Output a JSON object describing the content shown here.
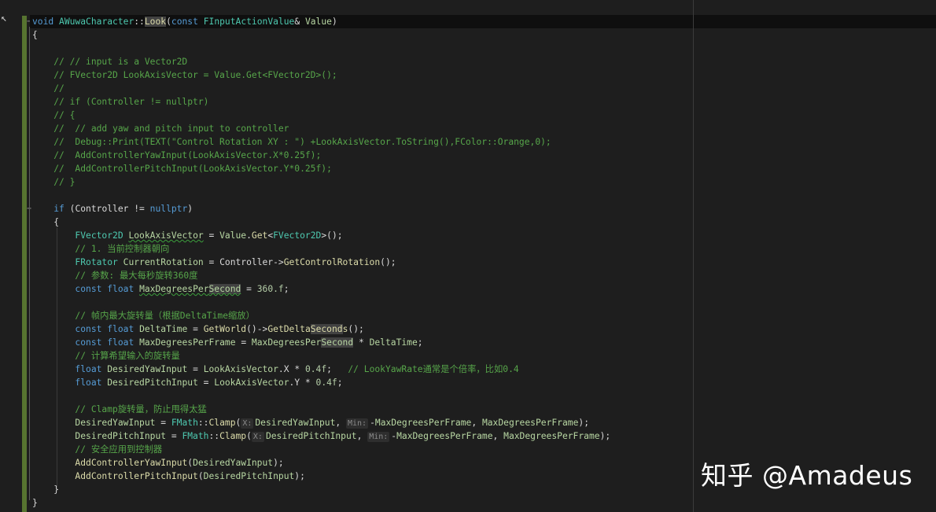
{
  "editor": {
    "cursor_glyph": "↖",
    "lines": [
      [
        {
          "t": "void",
          "c": "kw"
        },
        {
          "t": " "
        },
        {
          "t": "AWuwaCharacter",
          "c": "ty"
        },
        {
          "t": "::"
        },
        {
          "t": "Look",
          "c": "fn",
          "hl": true
        },
        {
          "t": "("
        },
        {
          "t": "const",
          "c": "kw"
        },
        {
          "t": " "
        },
        {
          "t": "FInputActionValue",
          "c": "ty"
        },
        {
          "t": "& "
        },
        {
          "t": "Value",
          "c": "lp"
        },
        {
          "t": ")"
        }
      ],
      [
        {
          "t": "{"
        }
      ],
      [],
      [
        {
          "t": "    // // input is a Vector2D",
          "c": "cm"
        }
      ],
      [
        {
          "t": "    // FVector2D LookAxisVector = Value.Get<FVector2D>();",
          "c": "cm"
        }
      ],
      [
        {
          "t": "    //",
          "c": "cm"
        }
      ],
      [
        {
          "t": "    // if (Controller != nullptr)",
          "c": "cm"
        }
      ],
      [
        {
          "t": "    // {",
          "c": "cm"
        }
      ],
      [
        {
          "t": "    //  // add yaw and pitch input to controller",
          "c": "cm"
        }
      ],
      [
        {
          "t": "    //  Debug::Print(TEXT(\"Control Rotation XY : \") +LookAxisVector.ToString(),FColor::Orange,0);",
          "c": "cm"
        }
      ],
      [
        {
          "t": "    //  AddControllerYawInput(LookAxisVector.X*0.25f);",
          "c": "cm"
        }
      ],
      [
        {
          "t": "    //  AddControllerPitchInput(LookAxisVector.Y*0.25f);",
          "c": "cm"
        }
      ],
      [
        {
          "t": "    // }",
          "c": "cm"
        }
      ],
      [],
      [
        {
          "t": "    "
        },
        {
          "t": "if",
          "c": "kw"
        },
        {
          "t": " ("
        },
        {
          "t": "Controller",
          "c": "mb"
        },
        {
          "t": " != "
        },
        {
          "t": "nullptr",
          "c": "kw"
        },
        {
          "t": ")"
        }
      ],
      [
        {
          "t": "    {"
        }
      ],
      [
        {
          "t": "        "
        },
        {
          "t": "FVector2D",
          "c": "ty"
        },
        {
          "t": " "
        },
        {
          "t": "LookAxisVector",
          "c": "lp",
          "sq": true
        },
        {
          "t": " = "
        },
        {
          "t": "Value",
          "c": "lp"
        },
        {
          "t": "."
        },
        {
          "t": "Get",
          "c": "fn"
        },
        {
          "t": "<"
        },
        {
          "t": "FVector2D",
          "c": "ty"
        },
        {
          "t": ">();"
        }
      ],
      [
        {
          "t": "        // 1. 当前控制器朝向",
          "c": "cm"
        }
      ],
      [
        {
          "t": "        "
        },
        {
          "t": "FRotator",
          "c": "ty"
        },
        {
          "t": " "
        },
        {
          "t": "CurrentRotation",
          "c": "lp"
        },
        {
          "t": " = "
        },
        {
          "t": "Controller",
          "c": "mb"
        },
        {
          "t": "->"
        },
        {
          "t": "GetControlRotation",
          "c": "fn"
        },
        {
          "t": "();"
        }
      ],
      [
        {
          "t": "        // 参数: 最大每秒旋转360度",
          "c": "cm"
        }
      ],
      [
        {
          "t": "        "
        },
        {
          "t": "const",
          "c": "kw"
        },
        {
          "t": " "
        },
        {
          "t": "float",
          "c": "kw"
        },
        {
          "t": " "
        },
        {
          "t": "MaxDegreesPer",
          "c": "lp",
          "sq": true
        },
        {
          "t": "Second",
          "c": "lp",
          "sq": true,
          "hl": true
        },
        {
          "t": " = "
        },
        {
          "t": "360.f",
          "c": "nm"
        },
        {
          "t": ";"
        }
      ],
      [],
      [
        {
          "t": "        // 帧内最大旋转量（根据DeltaTime缩放）",
          "c": "cm"
        }
      ],
      [
        {
          "t": "        "
        },
        {
          "t": "const",
          "c": "kw"
        },
        {
          "t": " "
        },
        {
          "t": "float",
          "c": "kw"
        },
        {
          "t": " "
        },
        {
          "t": "DeltaTime",
          "c": "lp"
        },
        {
          "t": " = "
        },
        {
          "t": "GetWorld",
          "c": "fn"
        },
        {
          "t": "()->"
        },
        {
          "t": "GetDelta",
          "c": "fn"
        },
        {
          "t": "Second",
          "c": "fn",
          "hl": true
        },
        {
          "t": "s",
          "c": "fn"
        },
        {
          "t": "();"
        }
      ],
      [
        {
          "t": "        "
        },
        {
          "t": "const",
          "c": "kw"
        },
        {
          "t": " "
        },
        {
          "t": "float",
          "c": "kw"
        },
        {
          "t": " "
        },
        {
          "t": "MaxDegreesPerFrame",
          "c": "lp"
        },
        {
          "t": " = "
        },
        {
          "t": "MaxDegreesPer",
          "c": "lp"
        },
        {
          "t": "Second",
          "c": "lp",
          "hl": true
        },
        {
          "t": " * "
        },
        {
          "t": "DeltaTime",
          "c": "lp"
        },
        {
          "t": ";"
        }
      ],
      [
        {
          "t": "        // 计算希望输入的旋转量",
          "c": "cm"
        }
      ],
      [
        {
          "t": "        "
        },
        {
          "t": "float",
          "c": "kw"
        },
        {
          "t": " "
        },
        {
          "t": "DesiredYawInput",
          "c": "lp"
        },
        {
          "t": " = "
        },
        {
          "t": "LookAxisVector",
          "c": "lp"
        },
        {
          "t": "."
        },
        {
          "t": "X",
          "c": "mb"
        },
        {
          "t": " * "
        },
        {
          "t": "0.4f",
          "c": "nm"
        },
        {
          "t": ";   "
        },
        {
          "t": "// LookYawRate通常是个倍率，比如0.4",
          "c": "cm"
        }
      ],
      [
        {
          "t": "        "
        },
        {
          "t": "float",
          "c": "kw"
        },
        {
          "t": " "
        },
        {
          "t": "DesiredPitchInput",
          "c": "lp"
        },
        {
          "t": " = "
        },
        {
          "t": "LookAxisVector",
          "c": "lp"
        },
        {
          "t": "."
        },
        {
          "t": "Y",
          "c": "mb"
        },
        {
          "t": " * "
        },
        {
          "t": "0.4f",
          "c": "nm"
        },
        {
          "t": ";"
        }
      ],
      [],
      [
        {
          "t": "        // Clamp旋转量，防止甩得太猛",
          "c": "cm"
        }
      ],
      [
        {
          "t": "        "
        },
        {
          "t": "DesiredYawInput",
          "c": "lp"
        },
        {
          "t": " = "
        },
        {
          "t": "FMath",
          "c": "ty"
        },
        {
          "t": "::"
        },
        {
          "t": "Clamp",
          "c": "fn"
        },
        {
          "t": "("
        },
        {
          "t": "X:",
          "c": "hint"
        },
        {
          "t": "DesiredYawInput",
          "c": "lp"
        },
        {
          "t": ", "
        },
        {
          "t": "Min:",
          "c": "hint"
        },
        {
          "t": "-"
        },
        {
          "t": "MaxDegreesPerFrame",
          "c": "lp"
        },
        {
          "t": ", "
        },
        {
          "t": "MaxDegreesPerFrame",
          "c": "lp"
        },
        {
          "t": ");"
        }
      ],
      [
        {
          "t": "        "
        },
        {
          "t": "DesiredPitchInput",
          "c": "lp"
        },
        {
          "t": " = "
        },
        {
          "t": "FMath",
          "c": "ty"
        },
        {
          "t": "::"
        },
        {
          "t": "Clamp",
          "c": "fn"
        },
        {
          "t": "("
        },
        {
          "t": "X:",
          "c": "hint"
        },
        {
          "t": "DesiredPitchInput",
          "c": "lp"
        },
        {
          "t": ", "
        },
        {
          "t": "Min:",
          "c": "hint"
        },
        {
          "t": "-"
        },
        {
          "t": "MaxDegreesPerFrame",
          "c": "lp"
        },
        {
          "t": ", "
        },
        {
          "t": "MaxDegreesPerFrame",
          "c": "lp"
        },
        {
          "t": ");"
        }
      ],
      [
        {
          "t": "        // 安全应用到控制器",
          "c": "cm"
        }
      ],
      [
        {
          "t": "        "
        },
        {
          "t": "AddControllerYawInput",
          "c": "fn"
        },
        {
          "t": "("
        },
        {
          "t": "DesiredYawInput",
          "c": "lp"
        },
        {
          "t": ");"
        }
      ],
      [
        {
          "t": "        "
        },
        {
          "t": "AddControllerPitchInput",
          "c": "fn"
        },
        {
          "t": "("
        },
        {
          "t": "DesiredPitchInput",
          "c": "lp"
        },
        {
          "t": ");"
        }
      ],
      [
        {
          "t": "    }"
        }
      ],
      [
        {
          "t": "}"
        }
      ]
    ]
  },
  "watermark": {
    "text": "知乎 @Amadeus"
  },
  "colors": {
    "background": "#1e1e1e",
    "keyword": "#569cd6",
    "type": "#4ec9b0",
    "comment": "#57a64a",
    "function": "#dcdcaa",
    "local": "#b8d7a3",
    "number": "#b5cea8",
    "change_bar": "#577430"
  }
}
